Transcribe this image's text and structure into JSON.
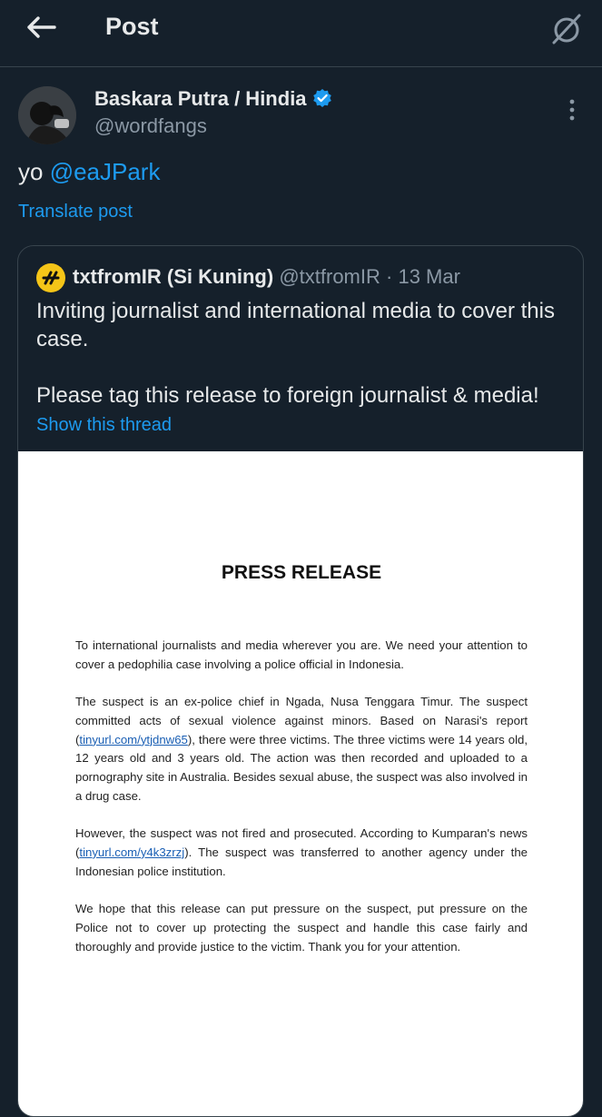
{
  "header": {
    "title": "Post",
    "back_icon": "arrow-left-icon",
    "grok_icon": "grok-icon"
  },
  "post": {
    "author_name": "Baskara Putra / Hindia",
    "author_handle": "@wordfangs",
    "verified_icon": "verified-badge-icon",
    "text_prefix": "yo ",
    "mention": "@eaJPark",
    "translate_label": "Translate post",
    "more_icon": "more-vertical-icon"
  },
  "quote": {
    "name": "txtfromIR (Si Kuning)",
    "handle": "@txtfromIR",
    "separator": " · ",
    "date": "13 Mar",
    "text": "Inviting journalist and international media to cover this case.\n\nPlease tag this release to foreign journalist & media!",
    "show_thread": "Show this thread"
  },
  "document": {
    "title": "PRESS RELEASE",
    "p1": "To international journalists and media wherever you are. We need your attention to cover a pedophilia case involving a police official in Indonesia.",
    "p2_a": "The suspect is an ex-police chief in Ngada, Nusa Tenggara Timur. The suspect committed acts of sexual violence against minors. Based on Narasi's report (",
    "p2_link": "tinyurl.com/ytjdnw65",
    "p2_b": "), there were three victims. The three victims were 14 years old, 12 years old and 3 years old. The action was then recorded and uploaded to a pornography site in Australia. Besides sexual abuse, the suspect was also involved in a drug case.",
    "p3_a": "However, the suspect was not fired and prosecuted. According to Kumparan's news (",
    "p3_link": "tinyurl.com/y4k3zrzj",
    "p3_b": "). The suspect was transferred to another agency under the Indonesian police institution.",
    "p4": "We hope that this release can put pressure on the suspect, put pressure on the Police not to cover up protecting the suspect and handle this case fairly and thoroughly and provide justice to the victim. Thank you for your attention."
  },
  "colors": {
    "background": "#15202b",
    "accent": "#1d9bf0",
    "muted": "#8b98a5",
    "border": "#38444d"
  }
}
